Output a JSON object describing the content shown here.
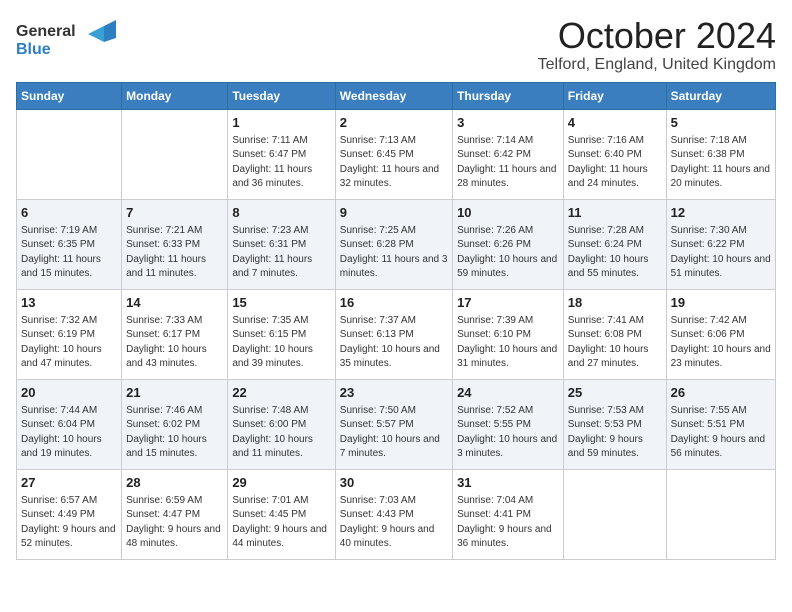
{
  "header": {
    "logo_general": "General",
    "logo_blue": "Blue",
    "month_title": "October 2024",
    "location": "Telford, England, United Kingdom"
  },
  "weekdays": [
    "Sunday",
    "Monday",
    "Tuesday",
    "Wednesday",
    "Thursday",
    "Friday",
    "Saturday"
  ],
  "weeks": [
    [
      {
        "day": "",
        "sunrise": "",
        "sunset": "",
        "daylight": ""
      },
      {
        "day": "",
        "sunrise": "",
        "sunset": "",
        "daylight": ""
      },
      {
        "day": "1",
        "sunrise": "Sunrise: 7:11 AM",
        "sunset": "Sunset: 6:47 PM",
        "daylight": "Daylight: 11 hours and 36 minutes."
      },
      {
        "day": "2",
        "sunrise": "Sunrise: 7:13 AM",
        "sunset": "Sunset: 6:45 PM",
        "daylight": "Daylight: 11 hours and 32 minutes."
      },
      {
        "day": "3",
        "sunrise": "Sunrise: 7:14 AM",
        "sunset": "Sunset: 6:42 PM",
        "daylight": "Daylight: 11 hours and 28 minutes."
      },
      {
        "day": "4",
        "sunrise": "Sunrise: 7:16 AM",
        "sunset": "Sunset: 6:40 PM",
        "daylight": "Daylight: 11 hours and 24 minutes."
      },
      {
        "day": "5",
        "sunrise": "Sunrise: 7:18 AM",
        "sunset": "Sunset: 6:38 PM",
        "daylight": "Daylight: 11 hours and 20 minutes."
      }
    ],
    [
      {
        "day": "6",
        "sunrise": "Sunrise: 7:19 AM",
        "sunset": "Sunset: 6:35 PM",
        "daylight": "Daylight: 11 hours and 15 minutes."
      },
      {
        "day": "7",
        "sunrise": "Sunrise: 7:21 AM",
        "sunset": "Sunset: 6:33 PM",
        "daylight": "Daylight: 11 hours and 11 minutes."
      },
      {
        "day": "8",
        "sunrise": "Sunrise: 7:23 AM",
        "sunset": "Sunset: 6:31 PM",
        "daylight": "Daylight: 11 hours and 7 minutes."
      },
      {
        "day": "9",
        "sunrise": "Sunrise: 7:25 AM",
        "sunset": "Sunset: 6:28 PM",
        "daylight": "Daylight: 11 hours and 3 minutes."
      },
      {
        "day": "10",
        "sunrise": "Sunrise: 7:26 AM",
        "sunset": "Sunset: 6:26 PM",
        "daylight": "Daylight: 10 hours and 59 minutes."
      },
      {
        "day": "11",
        "sunrise": "Sunrise: 7:28 AM",
        "sunset": "Sunset: 6:24 PM",
        "daylight": "Daylight: 10 hours and 55 minutes."
      },
      {
        "day": "12",
        "sunrise": "Sunrise: 7:30 AM",
        "sunset": "Sunset: 6:22 PM",
        "daylight": "Daylight: 10 hours and 51 minutes."
      }
    ],
    [
      {
        "day": "13",
        "sunrise": "Sunrise: 7:32 AM",
        "sunset": "Sunset: 6:19 PM",
        "daylight": "Daylight: 10 hours and 47 minutes."
      },
      {
        "day": "14",
        "sunrise": "Sunrise: 7:33 AM",
        "sunset": "Sunset: 6:17 PM",
        "daylight": "Daylight: 10 hours and 43 minutes."
      },
      {
        "day": "15",
        "sunrise": "Sunrise: 7:35 AM",
        "sunset": "Sunset: 6:15 PM",
        "daylight": "Daylight: 10 hours and 39 minutes."
      },
      {
        "day": "16",
        "sunrise": "Sunrise: 7:37 AM",
        "sunset": "Sunset: 6:13 PM",
        "daylight": "Daylight: 10 hours and 35 minutes."
      },
      {
        "day": "17",
        "sunrise": "Sunrise: 7:39 AM",
        "sunset": "Sunset: 6:10 PM",
        "daylight": "Daylight: 10 hours and 31 minutes."
      },
      {
        "day": "18",
        "sunrise": "Sunrise: 7:41 AM",
        "sunset": "Sunset: 6:08 PM",
        "daylight": "Daylight: 10 hours and 27 minutes."
      },
      {
        "day": "19",
        "sunrise": "Sunrise: 7:42 AM",
        "sunset": "Sunset: 6:06 PM",
        "daylight": "Daylight: 10 hours and 23 minutes."
      }
    ],
    [
      {
        "day": "20",
        "sunrise": "Sunrise: 7:44 AM",
        "sunset": "Sunset: 6:04 PM",
        "daylight": "Daylight: 10 hours and 19 minutes."
      },
      {
        "day": "21",
        "sunrise": "Sunrise: 7:46 AM",
        "sunset": "Sunset: 6:02 PM",
        "daylight": "Daylight: 10 hours and 15 minutes."
      },
      {
        "day": "22",
        "sunrise": "Sunrise: 7:48 AM",
        "sunset": "Sunset: 6:00 PM",
        "daylight": "Daylight: 10 hours and 11 minutes."
      },
      {
        "day": "23",
        "sunrise": "Sunrise: 7:50 AM",
        "sunset": "Sunset: 5:57 PM",
        "daylight": "Daylight: 10 hours and 7 minutes."
      },
      {
        "day": "24",
        "sunrise": "Sunrise: 7:52 AM",
        "sunset": "Sunset: 5:55 PM",
        "daylight": "Daylight: 10 hours and 3 minutes."
      },
      {
        "day": "25",
        "sunrise": "Sunrise: 7:53 AM",
        "sunset": "Sunset: 5:53 PM",
        "daylight": "Daylight: 9 hours and 59 minutes."
      },
      {
        "day": "26",
        "sunrise": "Sunrise: 7:55 AM",
        "sunset": "Sunset: 5:51 PM",
        "daylight": "Daylight: 9 hours and 56 minutes."
      }
    ],
    [
      {
        "day": "27",
        "sunrise": "Sunrise: 6:57 AM",
        "sunset": "Sunset: 4:49 PM",
        "daylight": "Daylight: 9 hours and 52 minutes."
      },
      {
        "day": "28",
        "sunrise": "Sunrise: 6:59 AM",
        "sunset": "Sunset: 4:47 PM",
        "daylight": "Daylight: 9 hours and 48 minutes."
      },
      {
        "day": "29",
        "sunrise": "Sunrise: 7:01 AM",
        "sunset": "Sunset: 4:45 PM",
        "daylight": "Daylight: 9 hours and 44 minutes."
      },
      {
        "day": "30",
        "sunrise": "Sunrise: 7:03 AM",
        "sunset": "Sunset: 4:43 PM",
        "daylight": "Daylight: 9 hours and 40 minutes."
      },
      {
        "day": "31",
        "sunrise": "Sunrise: 7:04 AM",
        "sunset": "Sunset: 4:41 PM",
        "daylight": "Daylight: 9 hours and 36 minutes."
      },
      {
        "day": "",
        "sunrise": "",
        "sunset": "",
        "daylight": ""
      },
      {
        "day": "",
        "sunrise": "",
        "sunset": "",
        "daylight": ""
      }
    ]
  ]
}
